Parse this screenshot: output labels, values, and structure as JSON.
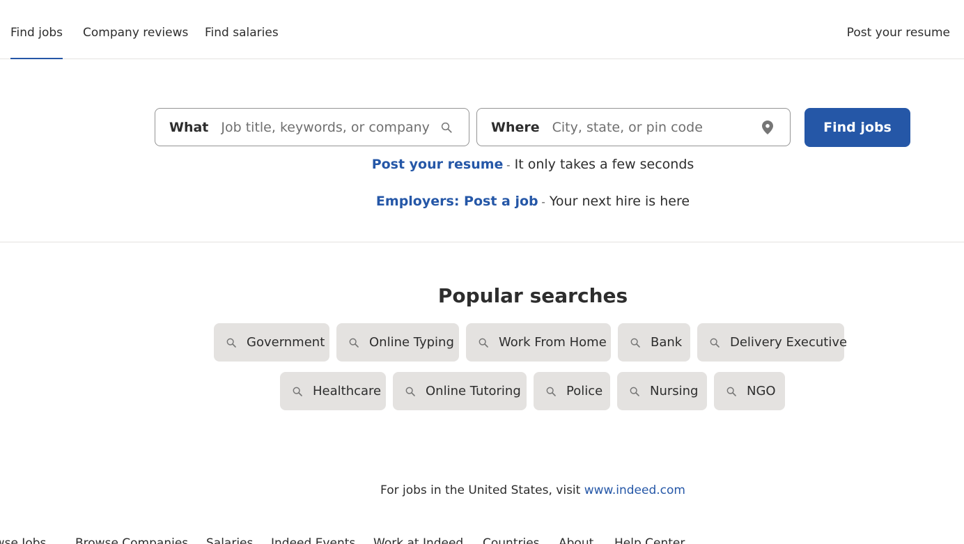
{
  "nav": {
    "find_jobs": "Find jobs",
    "company_reviews": "Company reviews",
    "find_salaries": "Find salaries",
    "post_resume": "Post your resume"
  },
  "search": {
    "what_label": "What",
    "what_placeholder": "Job title, keywords, or company",
    "where_label": "Where",
    "where_placeholder": "City, state, or pin code",
    "button_label": "Find jobs"
  },
  "promos": {
    "resume_link": "Post your resume",
    "resume_text": " It only takes a few seconds",
    "employer_link": "Employers: Post a job",
    "employer_text": " Your next hire is here",
    "separator": " -"
  },
  "popular": {
    "title": "Popular searches",
    "items": [
      "Government",
      "Online Typing",
      "Work From Home",
      "Bank",
      "Delivery Executive",
      "Healthcare",
      "Online Tutoring",
      "Police",
      "Nursing",
      "NGO"
    ]
  },
  "us_note": {
    "text": "For jobs in the United States, visit ",
    "link": "www.indeed.com"
  },
  "footer": {
    "links": [
      "Browse Jobs",
      "Browse Companies",
      "Salaries",
      "Indeed Events",
      "Work at Indeed",
      "Countries",
      "About",
      "Help Center"
    ]
  },
  "colors": {
    "brand_blue": "#2557a7",
    "chip_bg": "#e4e2e0",
    "text": "#2d2d2d"
  }
}
